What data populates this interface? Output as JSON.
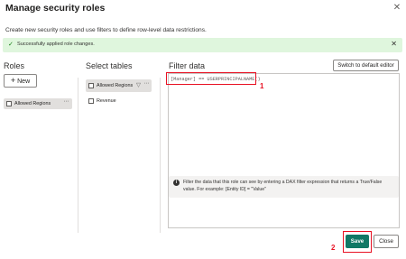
{
  "dialog": {
    "title": "Manage security roles",
    "close_glyph": "✕",
    "subtitle": "Create new security roles and use filters to define row-level data restrictions."
  },
  "banner": {
    "check_glyph": "✓",
    "message": "Successfully applied role changes.",
    "close_glyph": "✕",
    "background": "#dff6dd",
    "accent": "#107c10"
  },
  "roles": {
    "heading": "Roles",
    "new_button": {
      "plus": "+",
      "label": "New"
    },
    "items": [
      {
        "label": "Allowed Regions",
        "more": "···"
      }
    ]
  },
  "tables": {
    "heading": "Select tables",
    "selected": {
      "label": "Allowed Regions",
      "filter_icon": "filter-icon",
      "filter_glyph": "▽",
      "more": "···"
    },
    "items": [
      {
        "label": "Revenue"
      }
    ]
  },
  "filter": {
    "heading": "Filter data",
    "switch_button": "Switch to default editor",
    "expression": "[Manager] == USERPRINCIPALNAME()",
    "info_glyph": "i",
    "info_text": "Filter the data that this role can see by entering a DAX filter expression that returns a True/False value. For example: [Entity ID] = \"Value\""
  },
  "callouts": {
    "one": "1",
    "two": "2",
    "color": "#e81123"
  },
  "footer": {
    "save": "Save",
    "close": "Close",
    "save_color": "#117865"
  }
}
